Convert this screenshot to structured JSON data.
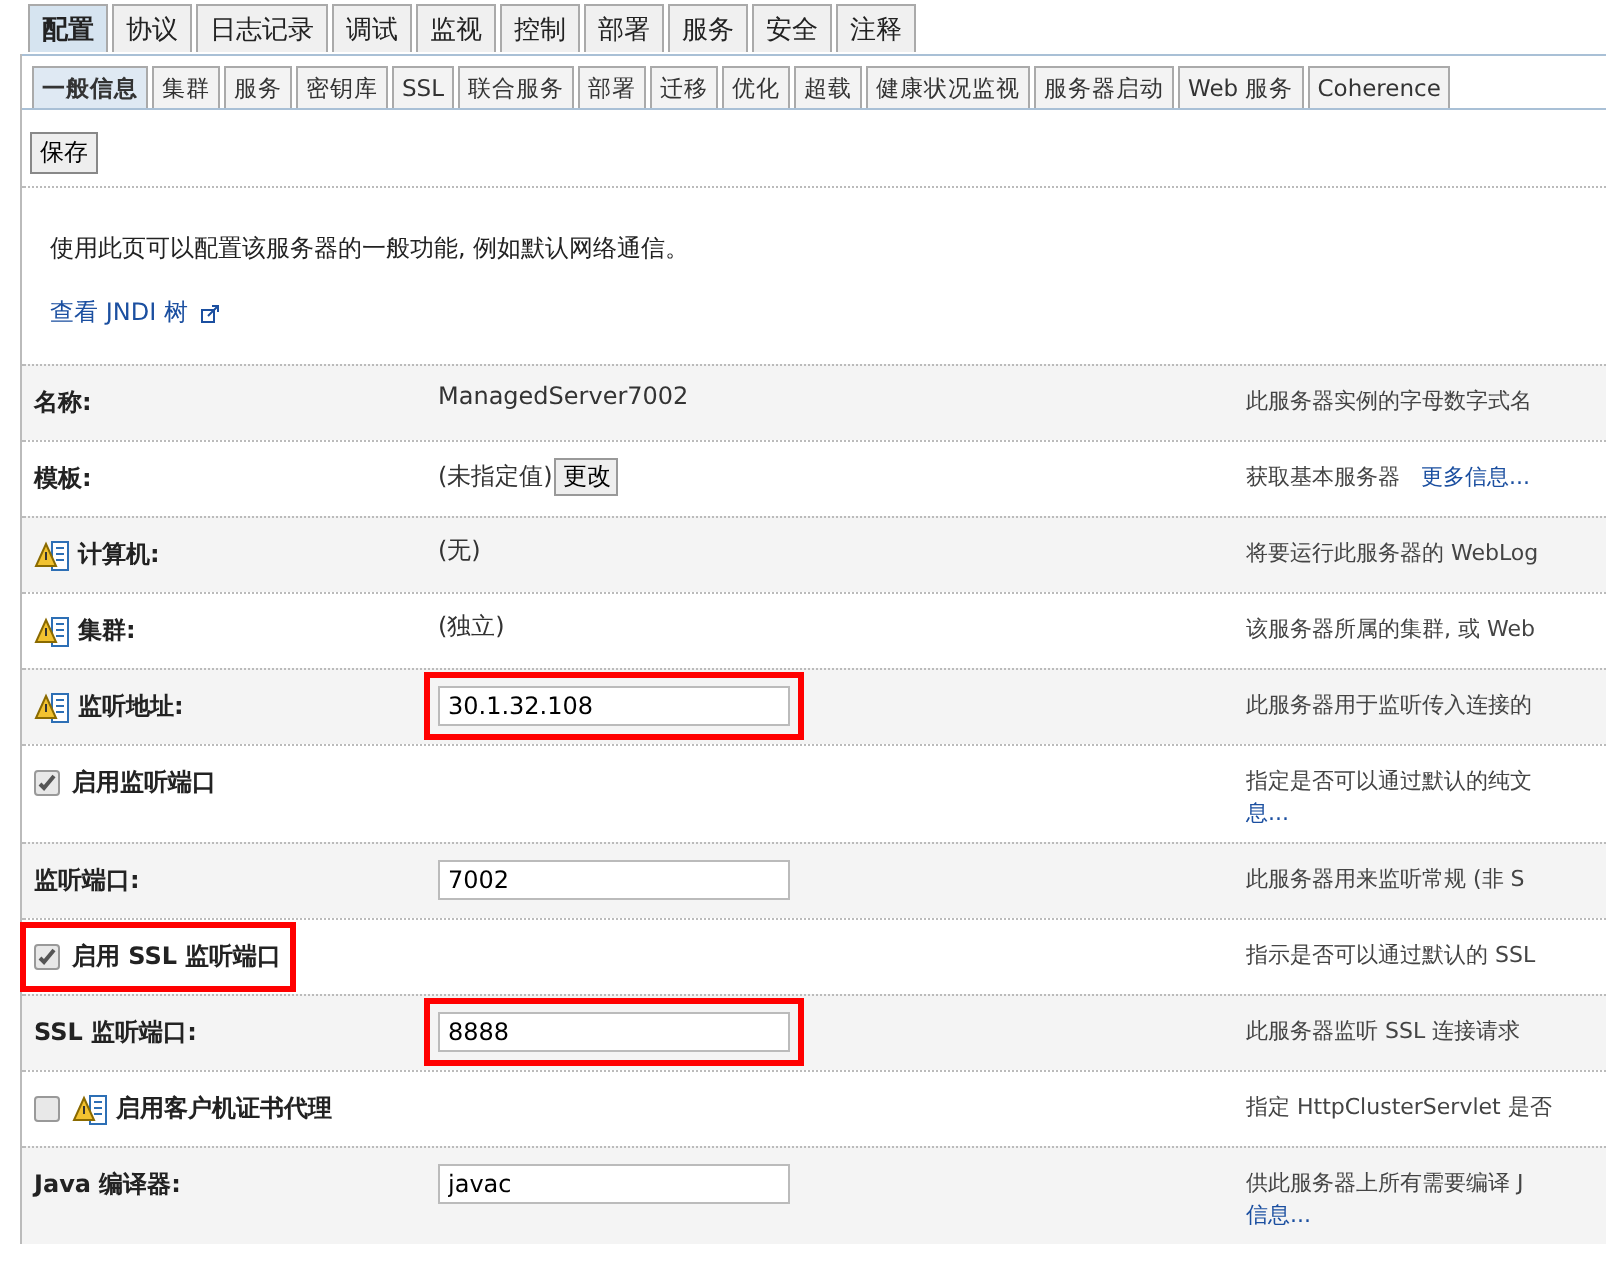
{
  "tabs": [
    {
      "label": "配置",
      "selected": true
    },
    {
      "label": "协议",
      "selected": false
    },
    {
      "label": "日志记录",
      "selected": false
    },
    {
      "label": "调试",
      "selected": false
    },
    {
      "label": "监视",
      "selected": false
    },
    {
      "label": "控制",
      "selected": false
    },
    {
      "label": "部署",
      "selected": false
    },
    {
      "label": "服务",
      "selected": false
    },
    {
      "label": "安全",
      "selected": false
    },
    {
      "label": "注释",
      "selected": false
    }
  ],
  "subtabs": [
    {
      "label": "一般信息",
      "selected": true
    },
    {
      "label": "集群",
      "selected": false
    },
    {
      "label": "服务",
      "selected": false
    },
    {
      "label": "密钥库",
      "selected": false
    },
    {
      "label": "SSL",
      "selected": false
    },
    {
      "label": "联合服务",
      "selected": false
    },
    {
      "label": "部署",
      "selected": false
    },
    {
      "label": "迁移",
      "selected": false
    },
    {
      "label": "优化",
      "selected": false
    },
    {
      "label": "超载",
      "selected": false
    },
    {
      "label": "健康状况监视",
      "selected": false
    },
    {
      "label": "服务器启动",
      "selected": false
    },
    {
      "label": "Web 服务",
      "selected": false
    },
    {
      "label": "Coherence",
      "selected": false
    }
  ],
  "save_button": "保存",
  "intro": "使用此页可以配置该服务器的一般功能, 例如默认网络通信。",
  "jndi_link": "查看 JNDI 树",
  "rows": [
    {
      "kind": "text",
      "label": "名称:",
      "value": "ManagedServer7002",
      "description": "此服务器实例的字母数字式名"
    },
    {
      "kind": "text",
      "label": "模板:",
      "value": "(未指定值)",
      "button": "更改",
      "description": "获取基本服务器",
      "link": "更多信息..."
    },
    {
      "kind": "text",
      "label": "计算机:",
      "warning": true,
      "value": "(无)",
      "description": "将要运行此服务器的 WebLog"
    },
    {
      "kind": "text",
      "label": "集群:",
      "warning": true,
      "value": "(独立)",
      "description": "该服务器所属的集群, 或 Web"
    },
    {
      "kind": "input",
      "label": "监听地址:",
      "warning": true,
      "highlighted": true,
      "value": "30.1.32.108",
      "description": "此服务器用于监听传入连接的"
    },
    {
      "kind": "checkbox",
      "label": "启用监听端口",
      "checked": true,
      "description": "指定是否可以通过默认的纯文",
      "link": "息..."
    },
    {
      "kind": "input",
      "label": "监听端口:",
      "value": "7002",
      "description": "此服务器用来监听常规 (非 S"
    },
    {
      "kind": "checkbox",
      "label": "启用 SSL 监听端口",
      "highlighted": true,
      "checked": true,
      "description": "指示是否可以通过默认的 SSL"
    },
    {
      "kind": "input",
      "label": "SSL 监听端口:",
      "highlighted": true,
      "value": "8888",
      "description": "此服务器监听 SSL 连接请求"
    },
    {
      "kind": "checkbox",
      "label": "启用客户机证书代理",
      "warning": true,
      "checked": false,
      "description": "指定 HttpClusterServlet 是否"
    },
    {
      "kind": "input",
      "label": "Java 编译器:",
      "value": "javac",
      "description": "供此服务器上所有需要编译 J",
      "link": "信息..."
    }
  ]
}
